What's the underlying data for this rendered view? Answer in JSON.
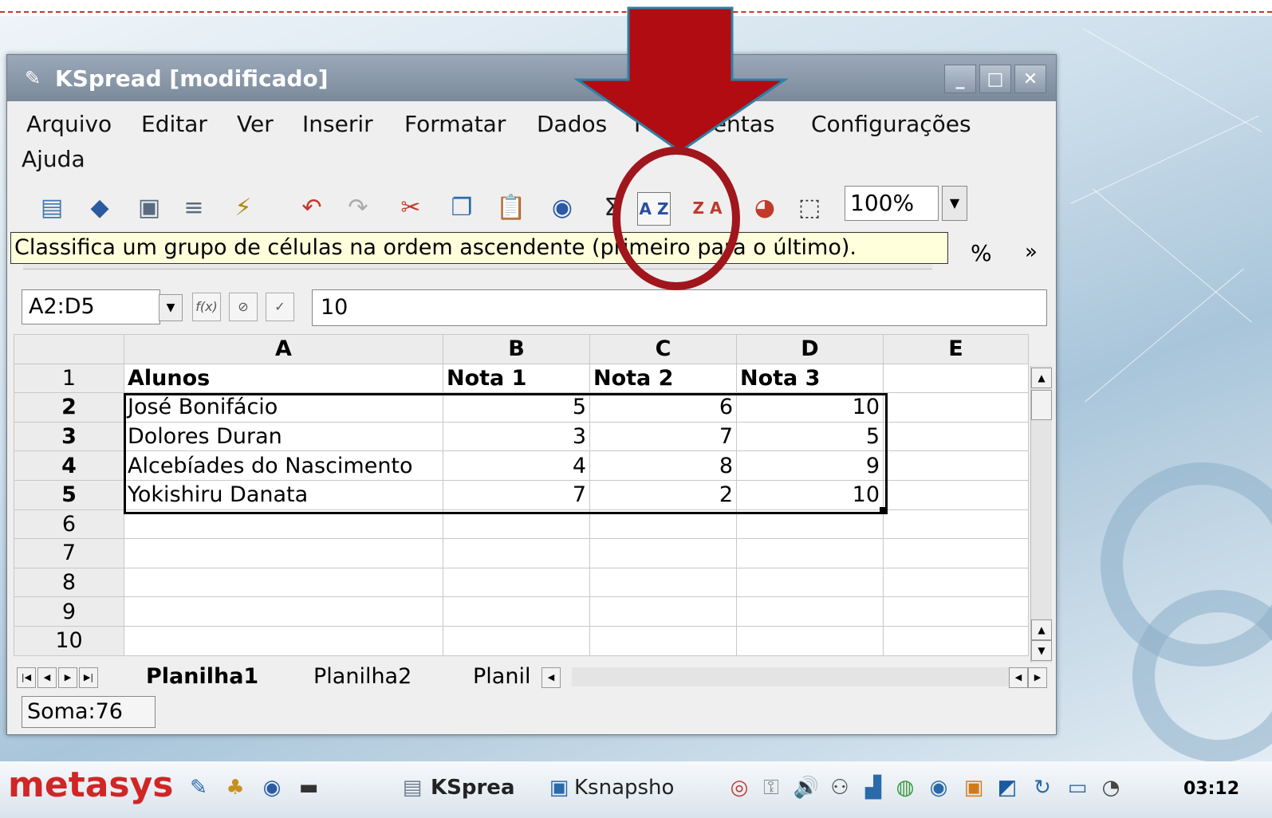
{
  "window": {
    "title": "KSpread [modificado]",
    "buttons": {
      "minimize": "_",
      "maximize": "□",
      "close": "✕"
    }
  },
  "menu": {
    "row1": [
      "Arquivo",
      "Editar",
      "Ver",
      "Inserir",
      "Formatar",
      "Dados",
      "Ferramentas",
      "Configurações"
    ],
    "row2": [
      "Ajuda"
    ]
  },
  "toolbar": {
    "zoom": "100%",
    "sort_asc_label": "A Z ↓",
    "sort_desc_label": "Z A ↑"
  },
  "tooltip": {
    "text": "Classifica um grupo de células na ordem ascendente (primeiro para o último)."
  },
  "toolbar2": {
    "percent": "%",
    "more": "»"
  },
  "formula_bar": {
    "cell_ref": "A2:D5",
    "value": "10",
    "fx": "f(x)"
  },
  "sheet": {
    "columns": [
      "A",
      "B",
      "C",
      "D",
      "E"
    ],
    "rows": [
      {
        "n": "1",
        "cells": [
          "Alunos",
          "Nota 1",
          "Nota 2",
          "Nota 3",
          ""
        ]
      },
      {
        "n": "2",
        "cells": [
          "José Bonifácio",
          "5",
          "6",
          "10",
          ""
        ]
      },
      {
        "n": "3",
        "cells": [
          "Dolores Duran",
          "3",
          "7",
          "5",
          ""
        ]
      },
      {
        "n": "4",
        "cells": [
          "Alcebíades do Nascimento",
          "4",
          "8",
          "9",
          ""
        ]
      },
      {
        "n": "5",
        "cells": [
          "Yokishiru Danata",
          "7",
          "2",
          "10",
          ""
        ]
      },
      {
        "n": "6",
        "cells": [
          "",
          "",
          "",
          "",
          ""
        ]
      },
      {
        "n": "7",
        "cells": [
          "",
          "",
          "",
          "",
          ""
        ]
      },
      {
        "n": "8",
        "cells": [
          "",
          "",
          "",
          "",
          ""
        ]
      },
      {
        "n": "9",
        "cells": [
          "",
          "",
          "",
          "",
          ""
        ]
      },
      {
        "n": "10",
        "cells": [
          "",
          "",
          "",
          "",
          ""
        ]
      }
    ]
  },
  "tabs": [
    "Planilha1",
    "Planilha2",
    "Planil"
  ],
  "status": {
    "sum": "Soma:76"
  },
  "taskbar": {
    "logo_a": "meta",
    "logo_b": "sys",
    "apps": [
      "KSprea",
      "Ksnapsho"
    ],
    "clock": "03:12"
  },
  "colors": {
    "annotation_red": "#b00c12",
    "arrow_outline": "#2f7fa6"
  }
}
